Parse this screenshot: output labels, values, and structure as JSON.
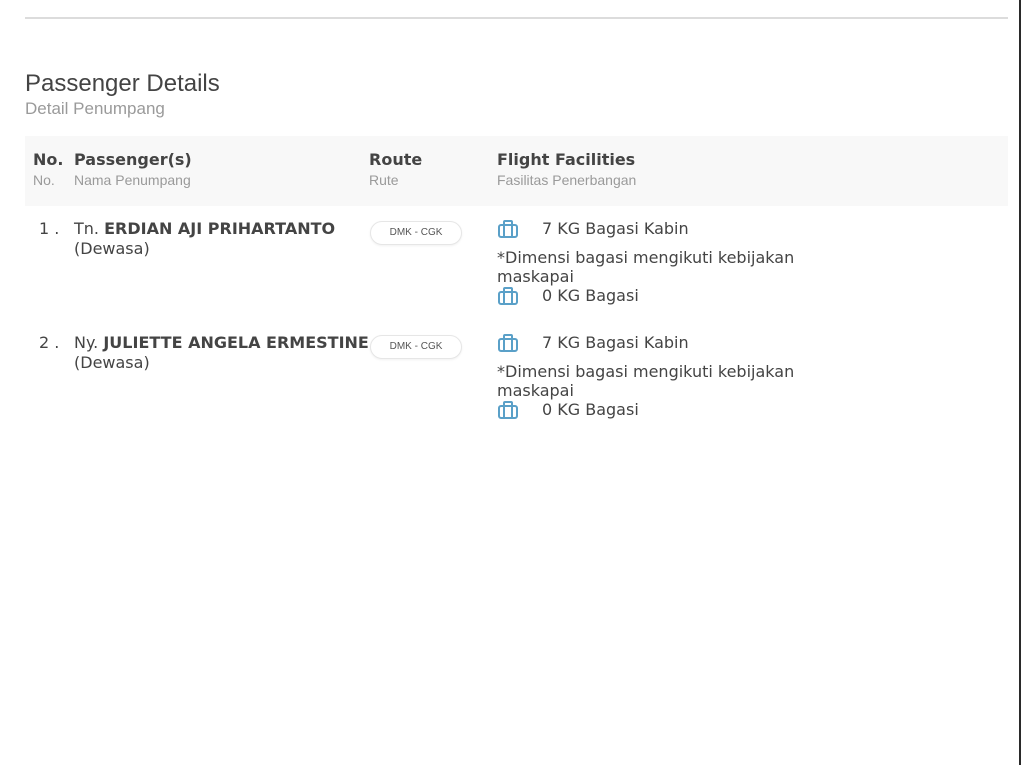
{
  "section": {
    "title": "Passenger Details",
    "subtitle": "Detail Penumpang"
  },
  "table": {
    "headers": [
      {
        "main": "No.",
        "sub": "No."
      },
      {
        "main": "Passenger(s)",
        "sub": "Nama Penumpang"
      },
      {
        "main": "Route",
        "sub": "Rute"
      },
      {
        "main": "Flight Facilities",
        "sub": "Fasilitas Penerbangan"
      }
    ],
    "rows": [
      {
        "no": "1 .",
        "title": "Tn.",
        "name": "ERDIAN AJI PRIHARTANTO",
        "type": "(Dewasa)",
        "route": "DMK - CGK",
        "cabin_baggage": "7 KG Bagasi Kabin",
        "note": "*Dimensi bagasi mengikuti kebijakan maskapai",
        "baggage": "0 KG Bagasi"
      },
      {
        "no": "2 .",
        "title": "Ny.",
        "name": "JULIETTE ANGELA ERMESTINE",
        "type": "(Dewasa)",
        "route": "DMK - CGK",
        "cabin_baggage": "7 KG Bagasi Kabin",
        "note": "*Dimensi bagasi mengikuti kebijakan maskapai",
        "baggage": "0 KG Bagasi"
      }
    ]
  },
  "icons": {
    "baggage": "luggage-icon"
  },
  "colors": {
    "icon": "#5aa0c8",
    "header_bg": "#f8f8f8",
    "subtext": "#9a9a9a"
  }
}
